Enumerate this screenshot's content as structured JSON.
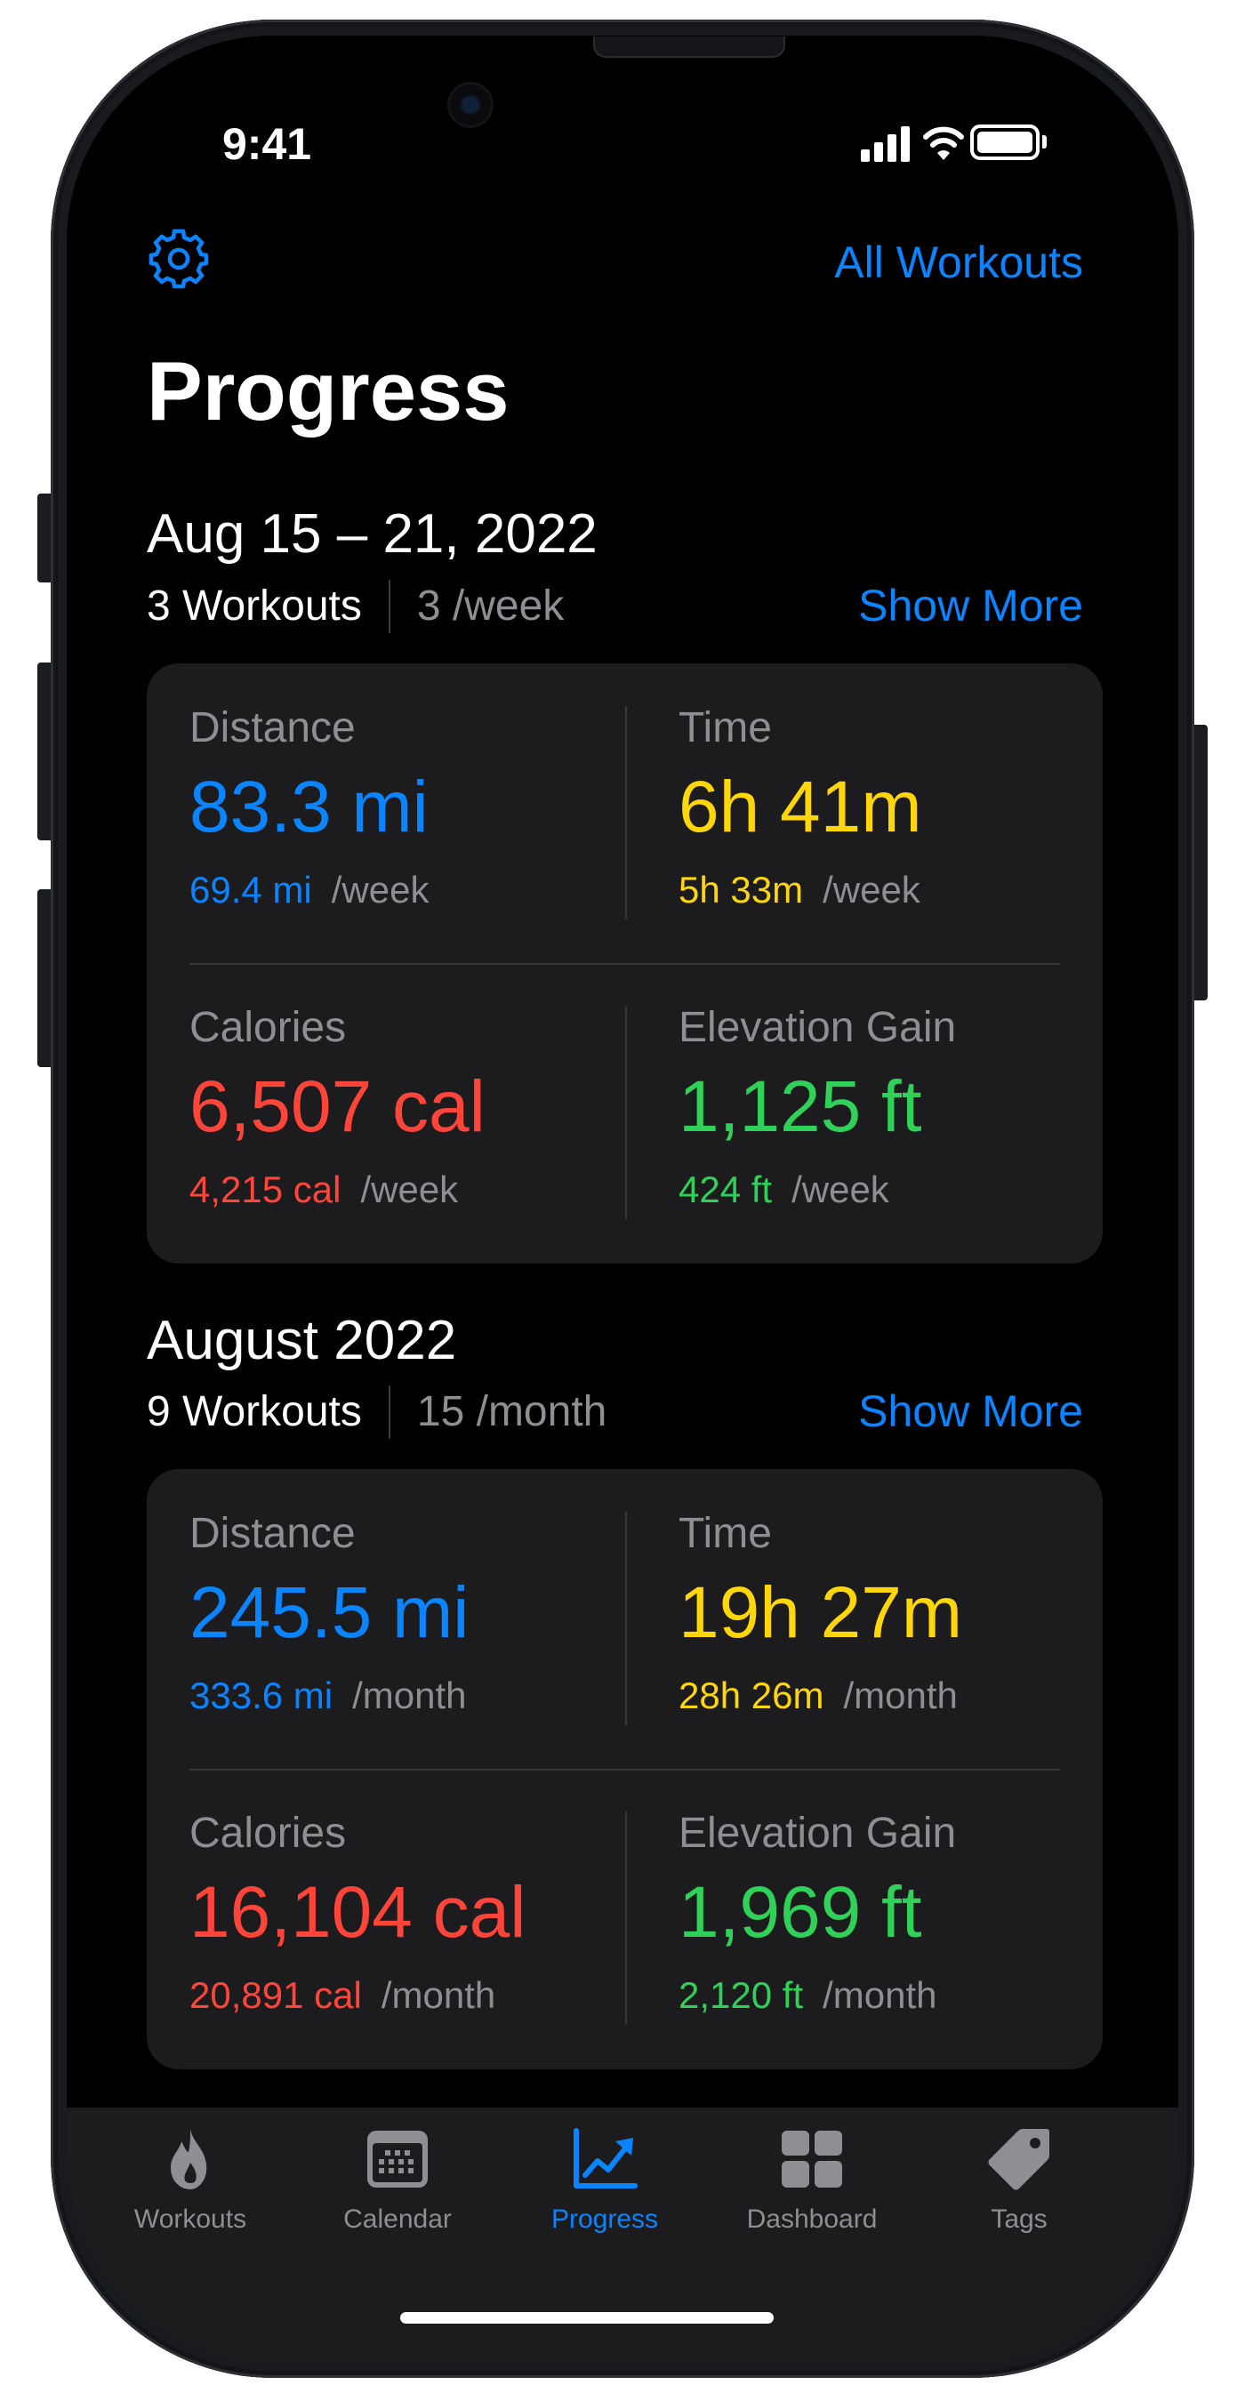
{
  "status_bar": {
    "time": "9:41"
  },
  "header": {
    "settings_icon": "gear-icon",
    "all_workouts_label": "All Workouts",
    "title": "Progress"
  },
  "colors": {
    "accent": "#0a84ff",
    "distance": "#0a84ff",
    "time": "#ffd60a",
    "calories": "#ff453a",
    "elevation": "#30d158",
    "card_bg": "#1c1c1e",
    "tabbar_bg": "#1c1c1e",
    "inactive_tab": "#8e8e93"
  },
  "sections": [
    {
      "title": "Aug 15 – 21, 2022",
      "count": "3 Workouts",
      "rate": "3 /week",
      "show_more": "Show More",
      "stats": {
        "distance": {
          "label": "Distance",
          "value": "83.3 mi",
          "avg": "69.4 mi",
          "unit": "/week"
        },
        "time": {
          "label": "Time",
          "value": "6h 41m",
          "avg": "5h 33m",
          "unit": "/week"
        },
        "calories": {
          "label": "Calories",
          "value": "6,507 cal",
          "avg": "4,215 cal",
          "unit": "/week"
        },
        "elevation": {
          "label": "Elevation Gain",
          "value": "1,125 ft",
          "avg": "424 ft",
          "unit": "/week"
        }
      }
    },
    {
      "title": "August 2022",
      "count": "9 Workouts",
      "rate": "15 /month",
      "show_more": "Show More",
      "stats": {
        "distance": {
          "label": "Distance",
          "value": "245.5 mi",
          "avg": "333.6 mi",
          "unit": "/month"
        },
        "time": {
          "label": "Time",
          "value": "19h 27m",
          "avg": "28h 26m",
          "unit": "/month"
        },
        "calories": {
          "label": "Calories",
          "value": "16,104 cal",
          "avg": "20,891 cal",
          "unit": "/month"
        },
        "elevation": {
          "label": "Elevation Gain",
          "value": "1,969 ft",
          "avg": "2,120 ft",
          "unit": "/month"
        }
      }
    }
  ],
  "tabs": [
    {
      "label": "Workouts",
      "icon": "flame-icon",
      "active": false
    },
    {
      "label": "Calendar",
      "icon": "calendar-icon",
      "active": false
    },
    {
      "label": "Progress",
      "icon": "chart-trend-icon",
      "active": true
    },
    {
      "label": "Dashboard",
      "icon": "grid-icon",
      "active": false
    },
    {
      "label": "Tags",
      "icon": "tag-icon",
      "active": false
    }
  ]
}
